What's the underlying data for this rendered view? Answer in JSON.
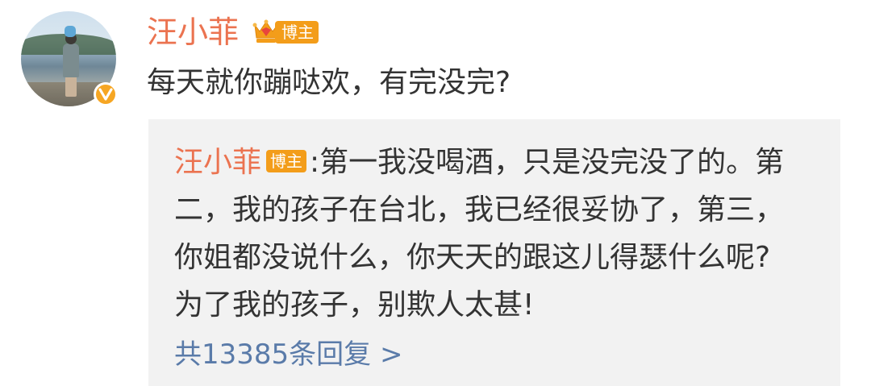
{
  "comment": {
    "username": "汪小菲",
    "badge_label": "博主",
    "text": "每天就你蹦哒欢，有完没完?"
  },
  "reply": {
    "username": "汪小菲",
    "badge_label": "博主",
    "colon": ":",
    "text": "第一我没喝酒，只是没完没了的。第二，我的孩子在台北，我已经很妥协了，第三，你姐都没说什么，你天天的跟这儿得瑟什么呢? 为了我的孩子，别欺人太甚!",
    "more_label": "共13385条回复 >"
  },
  "icons": {
    "avatar": "user-avatar",
    "verified": "verified-v-icon",
    "crown": "crown-icon"
  },
  "colors": {
    "username": "#eb7350",
    "badge": "#f39d1a",
    "link": "#5a7ba9",
    "reply_bg": "#f2f2f2",
    "text": "#333333"
  }
}
